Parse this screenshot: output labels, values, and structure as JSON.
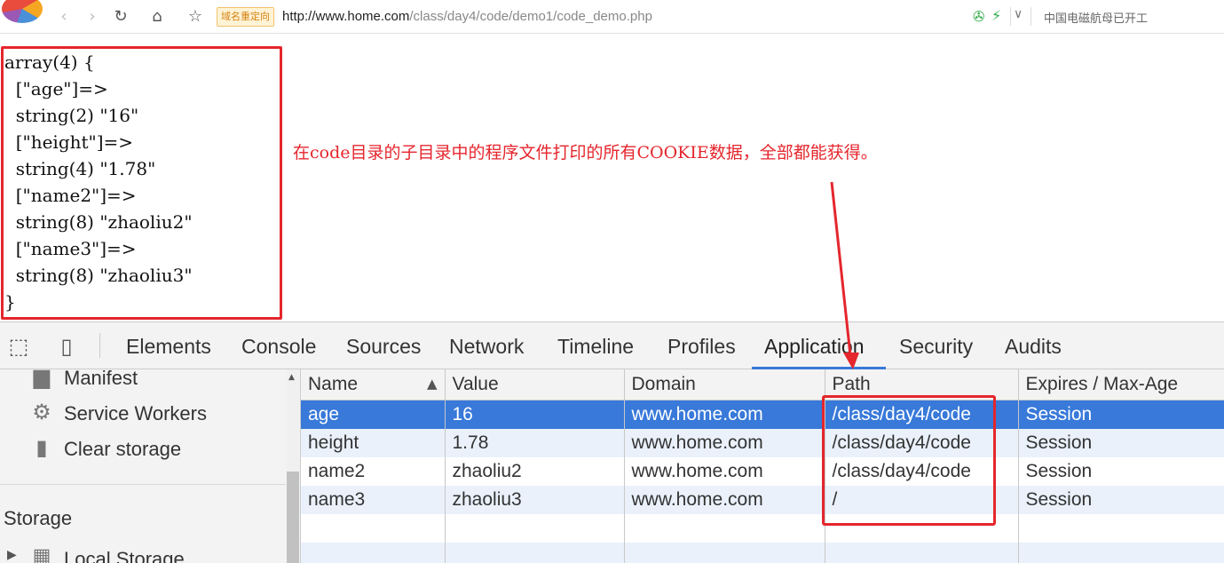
{
  "browser": {
    "url_host": "http://www.home.com",
    "url_path": "/class/day4/code/demo1/code_demo.php",
    "badge": "域名重定向",
    "news": "中国电磁航母已开工",
    "icons": [
      "back-icon",
      "forward-icon",
      "reload-icon",
      "home-icon",
      "star-icon"
    ]
  },
  "page": {
    "dump_lines": [
      "array(4) {",
      "  [\"age\"]=>",
      "  string(2) \"16\"",
      "  [\"height\"]=>",
      "  string(4) \"1.78\"",
      "  [\"name2\"]=>",
      "  string(8) \"zhaoliu2\"",
      "  [\"name3\"]=>",
      "  string(8) \"zhaoliu3\"",
      "}"
    ],
    "annotation": "在code目录的子目录中的程序文件打印的所有COOKIE数据，全部都能获得。"
  },
  "devtools": {
    "tabs": [
      "Elements",
      "Console",
      "Sources",
      "Network",
      "Timeline",
      "Profiles",
      "Application",
      "Security",
      "Audits"
    ],
    "active_tab": "Application",
    "sidebar": {
      "items": [
        {
          "label": "Manifest",
          "icon": "manifest-icon"
        },
        {
          "label": "Service Workers",
          "icon": "gear-icon"
        },
        {
          "label": "Clear storage",
          "icon": "trash-icon"
        }
      ],
      "section": "Storage",
      "storage_items": [
        {
          "label": "Local Storage",
          "icon": "grid-icon"
        }
      ]
    },
    "table": {
      "columns": [
        "Name",
        "Value",
        "Domain",
        "Path",
        "Expires / Max-Age"
      ],
      "sort_column": "Name",
      "rows": [
        {
          "name": "age",
          "value": "16",
          "domain": "www.home.com",
          "path": "/class/day4/code",
          "expires": "Session",
          "selected": true
        },
        {
          "name": "height",
          "value": "1.78",
          "domain": "www.home.com",
          "path": "/class/day4/code",
          "expires": "Session",
          "selected": false
        },
        {
          "name": "name2",
          "value": "zhaoliu2",
          "domain": "www.home.com",
          "path": "/class/day4/code",
          "expires": "Session",
          "selected": false
        },
        {
          "name": "name3",
          "value": "zhaoliu3",
          "domain": "www.home.com",
          "path": "/",
          "expires": "Session",
          "selected": false
        }
      ]
    }
  },
  "colors": {
    "annotation_red": "#e5262d",
    "selection_blue": "#3879d9",
    "row_stripe": "#eaf1fb"
  }
}
